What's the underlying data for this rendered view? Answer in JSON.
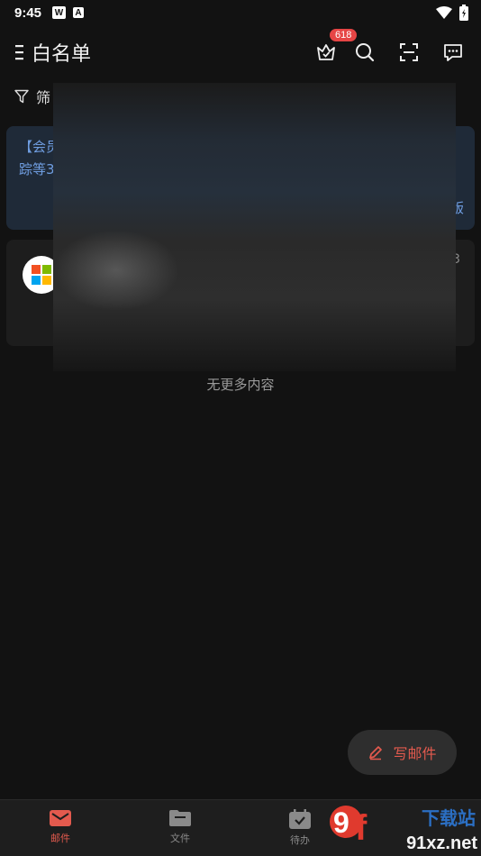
{
  "status_bar": {
    "time": "9:45",
    "app_icon_1": "W",
    "app_icon_2": "A"
  },
  "header": {
    "title": "白名单",
    "badge_count": "618"
  },
  "filter": {
    "label": "筛"
  },
  "promo": {
    "title": "【会员",
    "body": "踪等3",
    "tail": "版"
  },
  "mail": {
    "time": "3"
  },
  "list_end_text": "无更多内容",
  "compose": {
    "label": "写邮件"
  },
  "tabs": [
    {
      "label": "邮件",
      "icon": "mail-icon"
    },
    {
      "label": "文件",
      "icon": "folder-icon"
    },
    {
      "label": "待办",
      "icon": "calendar-check-icon"
    }
  ],
  "watermark": {
    "logo": "9f",
    "site": "91xz.net",
    "cn": "下载站"
  },
  "colors": {
    "accent": "#e35a4e",
    "promo_text": "#6f9de0",
    "badge": "#e64545"
  }
}
